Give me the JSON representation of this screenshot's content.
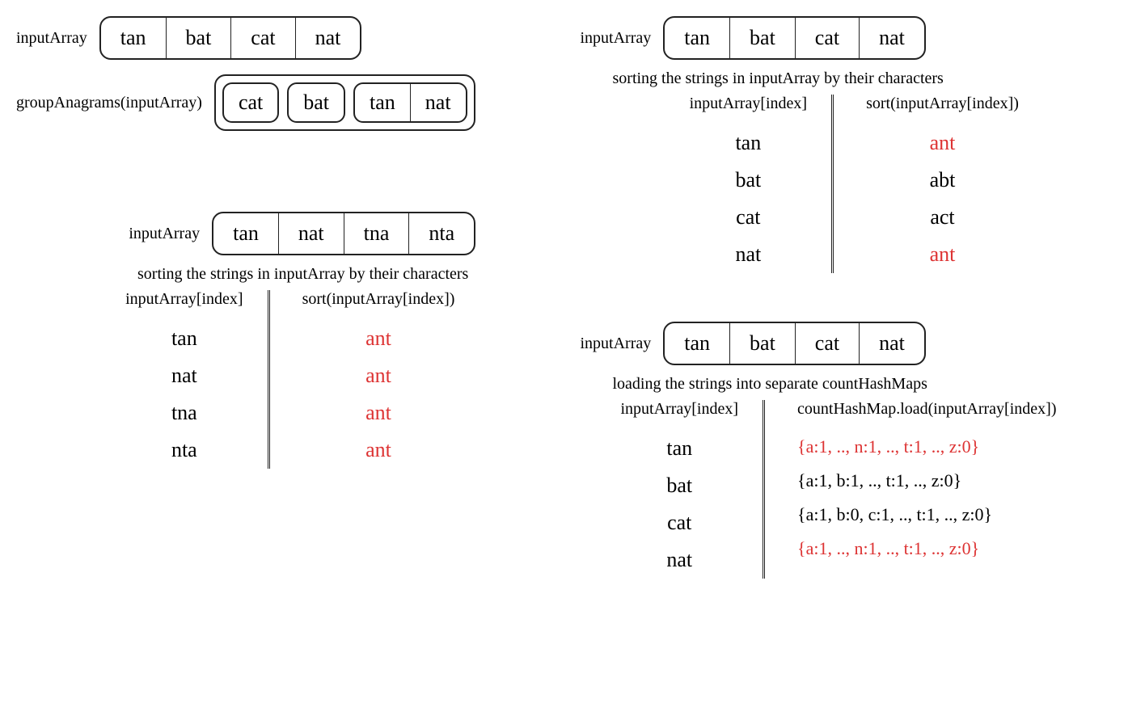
{
  "topLeft": {
    "label1": "inputArray",
    "arr1": [
      "tan",
      "bat",
      "cat",
      "nat"
    ],
    "label2": "groupAnagrams(inputArray)",
    "groups": [
      [
        "cat"
      ],
      [
        "bat"
      ],
      [
        "tan",
        "nat"
      ]
    ]
  },
  "topRight": {
    "label1": "inputArray",
    "arr1": [
      "tan",
      "bat",
      "cat",
      "nat"
    ],
    "subtitle": "sorting the strings in inputArray by their characters",
    "header1": "inputArray[index]",
    "header2": "sort(inputArray[index])",
    "rows": [
      {
        "in": "tan",
        "out": "ant",
        "red": true
      },
      {
        "in": "bat",
        "out": "abt",
        "red": false
      },
      {
        "in": "cat",
        "out": "act",
        "red": false
      },
      {
        "in": "nat",
        "out": "ant",
        "red": true
      }
    ]
  },
  "bottomLeft": {
    "label1": "inputArray",
    "arr1": [
      "tan",
      "nat",
      "tna",
      "nta"
    ],
    "subtitle": "sorting the strings in inputArray by their characters",
    "header1": "inputArray[index]",
    "header2": "sort(inputArray[index])",
    "rows": [
      {
        "in": "tan",
        "out": "ant",
        "red": true
      },
      {
        "in": "nat",
        "out": "ant",
        "red": true
      },
      {
        "in": "tna",
        "out": "ant",
        "red": true
      },
      {
        "in": "nta",
        "out": "ant",
        "red": true
      }
    ]
  },
  "bottomRight": {
    "label1": "inputArray",
    "arr1": [
      "tan",
      "bat",
      "cat",
      "nat"
    ],
    "subtitle": "loading the strings into separate countHashMaps",
    "header1": "inputArray[index]",
    "header2": "countHashMap.load(inputArray[index])",
    "rows": [
      {
        "in": "tan",
        "out": "{a:1, .., n:1, .., t:1, .., z:0}",
        "red": true
      },
      {
        "in": "bat",
        "out": "{a:1, b:1, .., t:1, .., z:0}",
        "red": false
      },
      {
        "in": "cat",
        "out": "{a:1, b:0, c:1, .., t:1, .., z:0}",
        "red": false
      },
      {
        "in": "nat",
        "out": "{a:1, .., n:1, .., t:1, .., z:0}",
        "red": true
      }
    ]
  }
}
